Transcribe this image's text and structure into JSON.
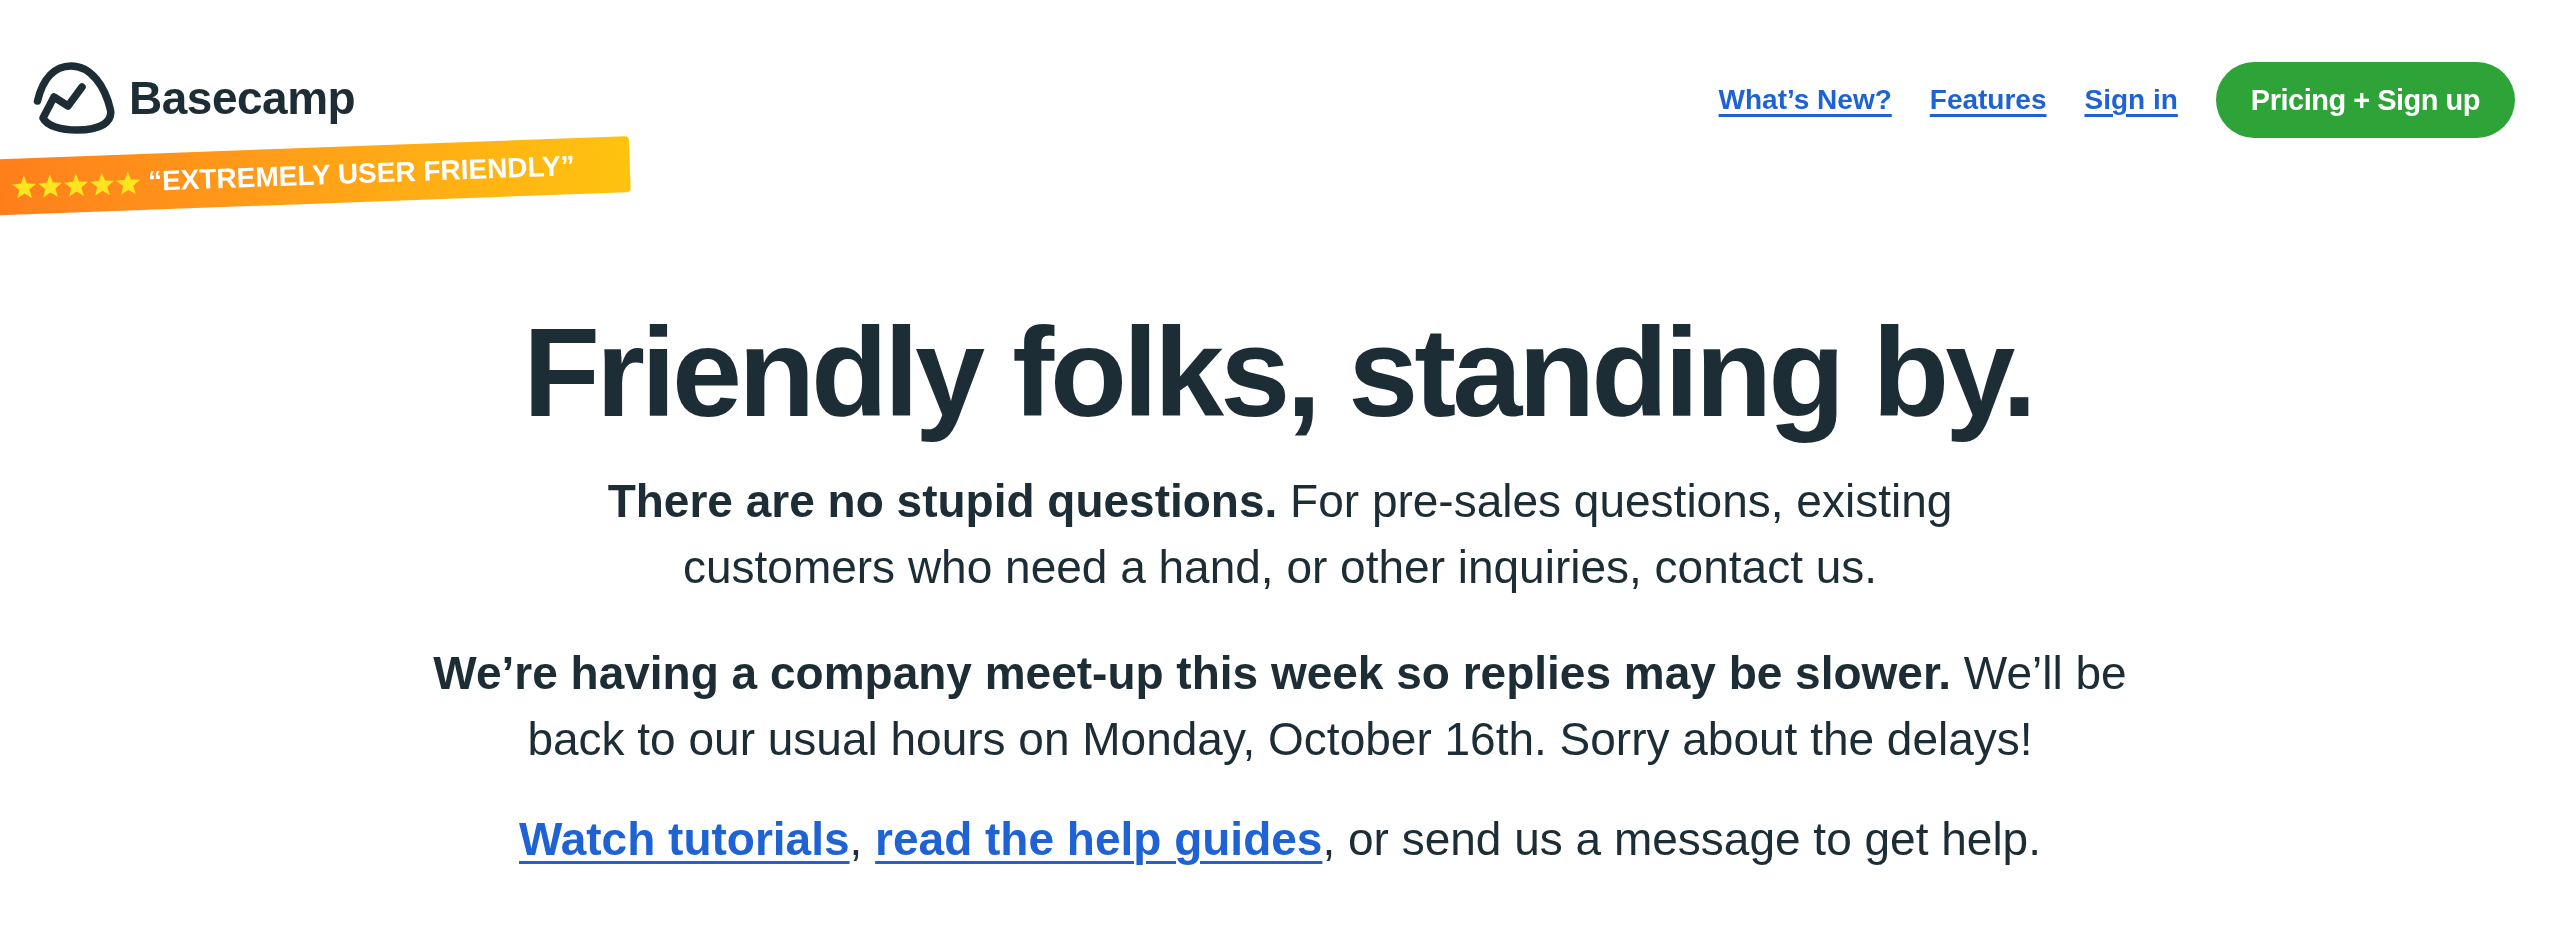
{
  "header": {
    "logo": {
      "name": "Basecamp"
    },
    "ribbon": {
      "stars": 5,
      "quote": "“EXTREMELY USER FRIENDLY”"
    },
    "nav_links": [
      "What’s New?",
      "Features",
      "Sign in"
    ],
    "cta_button": "Pricing + Sign up"
  },
  "hero": {
    "heading": "Friendly folks, standing by.",
    "intro": "**There are no stupid questions.** For pre-sales questions, existing customers who need a hand, or other inquiries, contact us.",
    "notice": "**We’re having a company meet-up this week so replies may be slower.** We’ll be back to our usual hours on Monday, October 16th. Sorry about the delays!",
    "help_line": {
      "links": [
        "Watch tutorials",
        "read the help guides"
      ],
      "separator": ", ",
      "tail": ", or send us a message to get help."
    }
  }
}
